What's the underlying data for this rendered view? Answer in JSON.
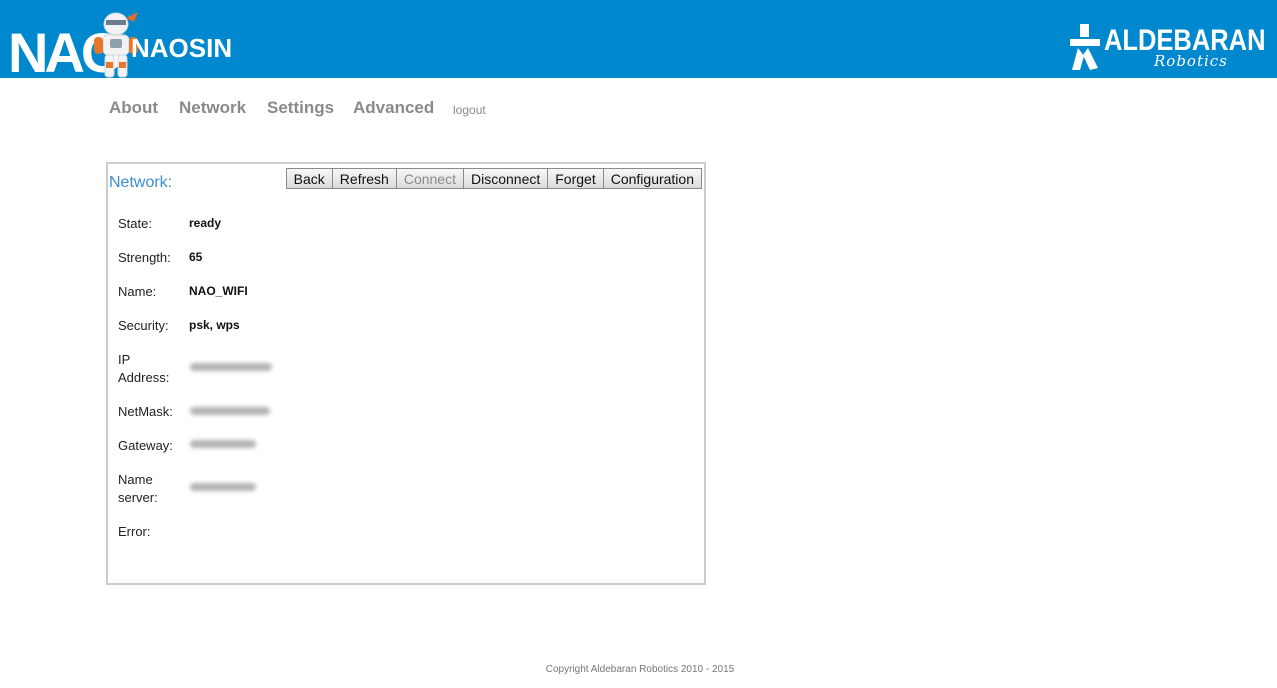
{
  "header": {
    "logo_text": "NAO",
    "app_name": "NAOSIN",
    "brand_text": "ALDEBARAN",
    "brand_subtext": "Robotics",
    "background_color": "#0088cf"
  },
  "nav": {
    "items": [
      "About",
      "Network",
      "Settings",
      "Advanced"
    ],
    "logout_label": "logout"
  },
  "panel": {
    "title": "Network:",
    "title_color": "#3c8ed0",
    "buttons": {
      "back": "Back",
      "refresh": "Refresh",
      "connect": "Connect",
      "disconnect": "Disconnect",
      "forget": "Forget",
      "configuration": "Configuration"
    },
    "fields": {
      "state_label": "State:",
      "state_value": "ready",
      "strength_label": "Strength:",
      "strength_value": "65",
      "name_label": "Name:",
      "name_value": "NAO_WIFI",
      "security_label": "Security:",
      "security_value": "psk, wps",
      "ip_label": "IP Address:",
      "netmask_label": "NetMask:",
      "gateway_label": "Gateway:",
      "nameserver_label": "Name server:",
      "error_label": "Error:"
    }
  },
  "footer": {
    "copyright": "Copyright Aldebaran Robotics 2010 - 2015"
  }
}
